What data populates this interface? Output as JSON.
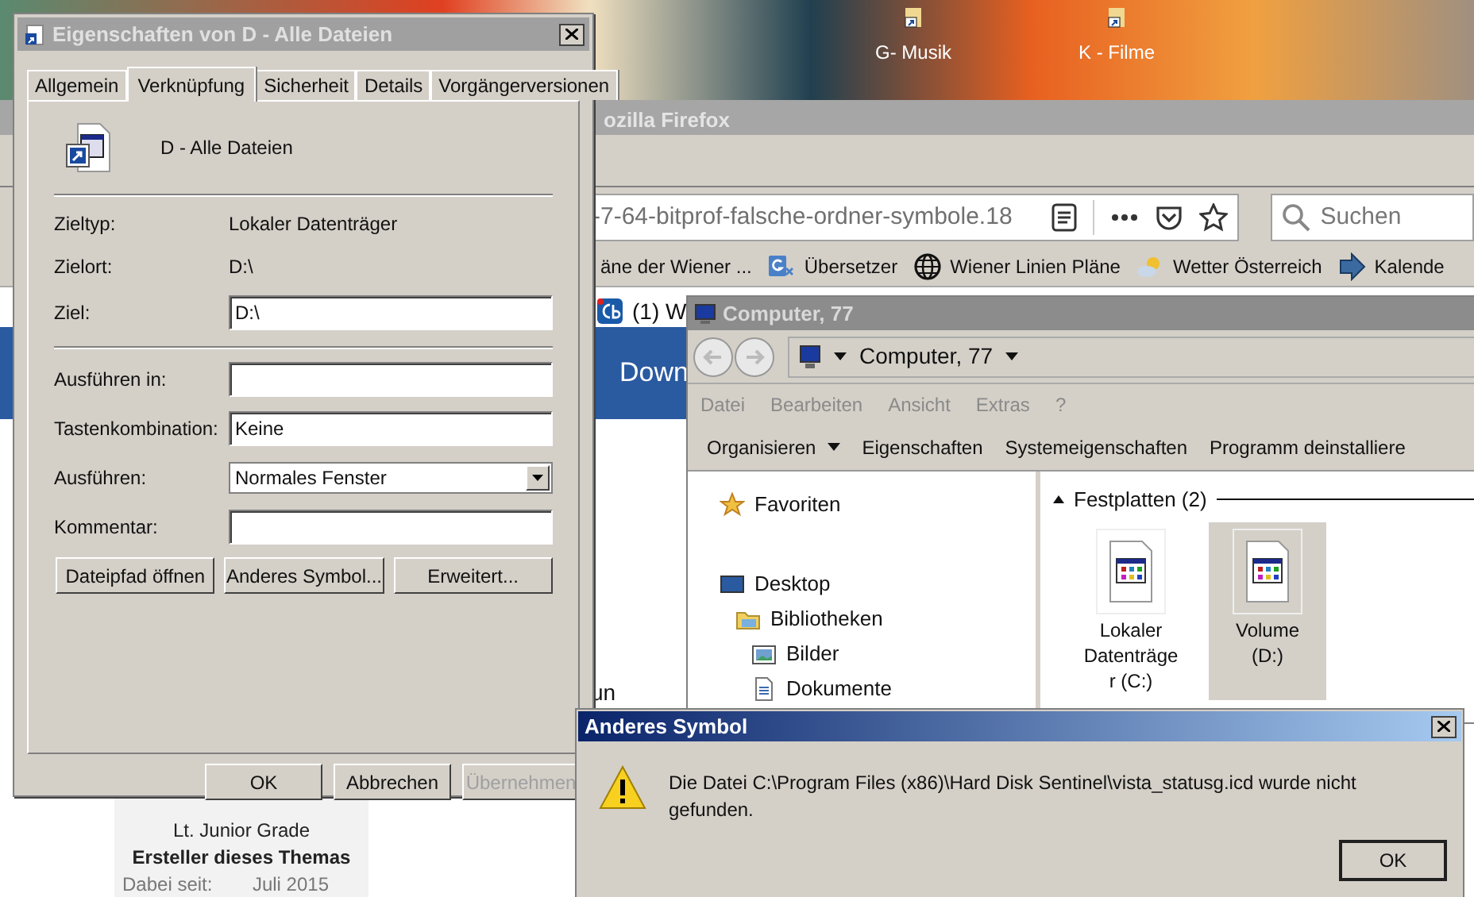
{
  "desktop": {
    "icons": [
      {
        "label": "G- Musik"
      },
      {
        "label": "K - Filme"
      }
    ]
  },
  "browser": {
    "title_fragments": [
      "ozilla Firefox"
    ],
    "url": "-7-64-bitprof-falsche-ordner-symbole.18",
    "search": {
      "placeholder": "Suchen"
    },
    "bookmarks": [
      {
        "label": "äne der Wiener ...",
        "kind": "plain"
      },
      {
        "label": "Übersetzer",
        "kind": "translate"
      },
      {
        "label": "Wiener Linien Pläne",
        "kind": "globe"
      },
      {
        "label": "Wetter Österreich",
        "kind": "weather"
      },
      {
        "label": "Kalende",
        "kind": "arrow"
      }
    ],
    "tab": {
      "label": "(1) W"
    },
    "banner": {
      "text": "Down"
    },
    "page_fragment": "un",
    "profile": {
      "rank": "Lt. Junior Grade",
      "role": "Ersteller dieses Themas",
      "since_label": "Dabei seit:",
      "since": "Juli 2015"
    }
  },
  "properties_dialog": {
    "title": "Eigenschaften von D - Alle Dateien",
    "tabs": [
      {
        "label": "Allgemein",
        "selected": false
      },
      {
        "label": "Verknüpfung",
        "selected": true
      },
      {
        "label": "Sicherheit",
        "selected": false
      },
      {
        "label": "Details",
        "selected": false
      },
      {
        "label": "Vorgängerversionen",
        "selected": false
      }
    ],
    "name": "D - Alle Dateien",
    "sections": [
      {
        "rows": [
          {
            "label": "Zieltyp:",
            "kind": "static",
            "value": "Lokaler Datenträger"
          },
          {
            "label": "Zielort:",
            "kind": "static",
            "value": "D:\\"
          },
          {
            "label": "Ziel:",
            "kind": "input",
            "value": "D:\\"
          }
        ]
      },
      {
        "rows": [
          {
            "label": "Ausführen in:",
            "kind": "input"
          },
          {
            "label": "Tastenkombination:",
            "kind": "input",
            "value": "Keine"
          },
          {
            "label": "Ausführen:",
            "kind": "select",
            "value": "Normales Fenster"
          },
          {
            "label": "Kommentar:",
            "kind": "input"
          }
        ]
      }
    ],
    "actions": [
      {
        "label": "Dateipfad öffnen"
      },
      {
        "label": "Anderes Symbol..."
      },
      {
        "label": "Erweitert..."
      }
    ],
    "buttons": [
      {
        "label": "OK",
        "disabled": false
      },
      {
        "label": "Abbrechen",
        "disabled": false
      },
      {
        "label": "Übernehmen",
        "disabled": true
      }
    ]
  },
  "explorer": {
    "title": "Computer, 77",
    "address": "Computer, 77",
    "menu": [
      "Datei",
      "Bearbeiten",
      "Ansicht",
      "Extras",
      "?"
    ],
    "toolbar": [
      {
        "label": "Organisieren",
        "dropdown": true
      },
      {
        "label": "Eigenschaften",
        "dropdown": false
      },
      {
        "label": "Systemeigenschaften",
        "dropdown": false
      },
      {
        "label": "Programm deinstalliere",
        "dropdown": false
      }
    ],
    "nav": [
      {
        "label": "Favoriten",
        "kind": "star"
      },
      {
        "label": "Desktop",
        "kind": "desktop",
        "children": [
          {
            "label": "Bibliotheken",
            "kind": "library",
            "children": [
              {
                "label": "Bilder",
                "kind": "pictures"
              },
              {
                "label": "Dokumente",
                "kind": "document"
              }
            ]
          }
        ]
      }
    ],
    "group": {
      "label": "Festplatten (2)",
      "expanded": true
    },
    "drives": [
      {
        "label": "Lokaler Datenträger (C:)",
        "selected": false
      },
      {
        "label": "Volume (D:)",
        "selected": true
      }
    ]
  },
  "alert": {
    "title": "Anderes Symbol",
    "message": "Die Datei C:\\Program Files (x86)\\Hard Disk Sentinel\\vista_statusg.icd wurde nicht gefunden.",
    "buttons": [
      {
        "label": "OK"
      }
    ]
  }
}
